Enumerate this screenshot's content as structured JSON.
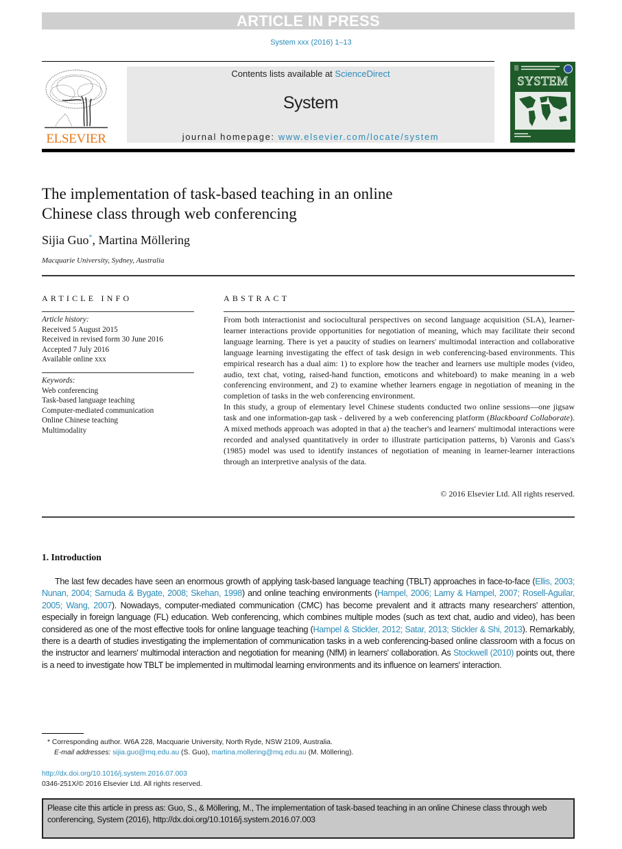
{
  "banner": {
    "text": "ARTICLE IN PRESS"
  },
  "journal_ref": "System xxx (2016) 1–13",
  "masthead": {
    "publisher_word": "ELSEVIER",
    "contents_prefix": "Contents lists available at ",
    "contents_link": "ScienceDirect",
    "journal_name": "System",
    "homepage_prefix": "journal homepage: ",
    "homepage_link": "www.elsevier.com/locate/system",
    "cover_title": "SYSTEM",
    "colors": {
      "publisher_orange": "#e77817",
      "cover_green": "#1f5a2a",
      "link_blue": "#2a8ab8"
    }
  },
  "article": {
    "title_line1": "The implementation of task-based teaching in an online",
    "title_line2": "Chinese class through web conferencing",
    "author1": "Sijia Guo",
    "author1_mark": "*",
    "author_sep": ", ",
    "author2": "Martina Möllering",
    "affiliation": "Macquarie University, Sydney, Australia"
  },
  "article_info": {
    "heading": "ARTICLE INFO",
    "history_label": "Article history:",
    "history": [
      "Received 5 August 2015",
      "Received in revised form 30 June 2016",
      "Accepted 7 July 2016",
      "Available online xxx"
    ],
    "keywords_label": "Keywords:",
    "keywords": [
      "Web conferencing",
      "Task-based language teaching",
      "Computer-mediated communication",
      "Online Chinese teaching",
      "Multimodality"
    ]
  },
  "abstract": {
    "heading": "ABSTRACT",
    "para1": "From both interactionist and sociocultural perspectives on second language acquisition (SLA), learner-learner interactions provide opportunities for negotiation of meaning, which may facilitate their second language learning. There is yet a paucity of studies on learners' multimodal interaction and collaborative language learning investigating the effect of task design in web conferencing-based environments. This empirical research has a dual aim: 1) to explore how the teacher and learners use multiple modes (video, audio, text chat, voting, raised-hand function, emoticons and whiteboard) to make meaning in a web conferencing environment, and 2) to examine whether learners engage in negotiation of meaning in the completion of tasks in the web conferencing environment.",
    "para2_a": "In this study, a group of elementary level Chinese students conducted two online ses­sions—one jigsaw task and one information-gap task - delivered by a web conferencing platform (",
    "para2_italic": "Blackboard Collaborate",
    "para2_b": "). A mixed methods approach was adopted in that a) the teacher's and learners' multimodal interactions were recorded and analysed quantitatively in order to illustrate participation patterns, b) Varonis and Gass's (1985) model was used to identify instances of negotiation of meaning in learner-learner interactions through an interpretive analysis of the data.",
    "copyright": "© 2016 Elsevier Ltd. All rights reserved."
  },
  "introduction": {
    "heading": "1.  Introduction",
    "t1": "The last few decades have seen an enormous growth of applying task-based language teaching (TBLT) approaches in face-to-face (",
    "c1": "Ellis, 2003; Nunan, 2004; Samuda & Bygate, 2008; Skehan, 1998",
    "t2": ") and online teaching environments (",
    "c2": "Hampel, 2006; Lamy & Hampel, 2007; Rosell-Aguilar, 2005; Wang, 2007",
    "t3": "). Nowadays, computer-mediated communication (CMC) has become prevalent and it attracts many researchers' attention, especially in foreign language (FL) education. Web confer­encing, which combines multiple modes (such as text chat, audio and video), has been considered as one of the most effective tools for online language teaching (",
    "c3": "Hampel & Stickler, 2012; Satar, 2013; Stickler & Shi, 2013",
    "t4": "). Remarkably, there is a dearth of studies investigating the implementation of communication tasks in a web conferencing-based online classroom with a focus on the instructor and learners' multimodal interaction and negotiation for meaning (NfM) in learners' collaboration. As ",
    "c4": "Stockwell (2010)",
    "t5": " points out, there is a need to investigate how TBLT be implemented in multimodal learning environments and its influence on learners' interaction."
  },
  "footnotes": {
    "star": "*",
    "corresponding": " Corresponding author. W6A 228, Macquarie University, North Ryde, NSW 2109, Australia.",
    "email_label": "E-mail addresses:",
    "email1": "sijia.guo@mq.edu.au",
    "email1_owner": " (S. Guo), ",
    "email2": "martina.mollering@mq.edu.au",
    "email2_owner": " (M. Möllering).",
    "doi": "http://dx.doi.org/10.1016/j.system.2016.07.003",
    "issn_line": "0346-251X/© 2016 Elsevier Ltd. All rights reserved."
  },
  "cite_box": {
    "text": "Please cite this article in press as: Guo, S., & Möllering, M., The implementation of task-based teaching in an online Chinese class through web conferencing, System (2016), http://dx.doi.org/10.1016/j.system.2016.07.003"
  }
}
